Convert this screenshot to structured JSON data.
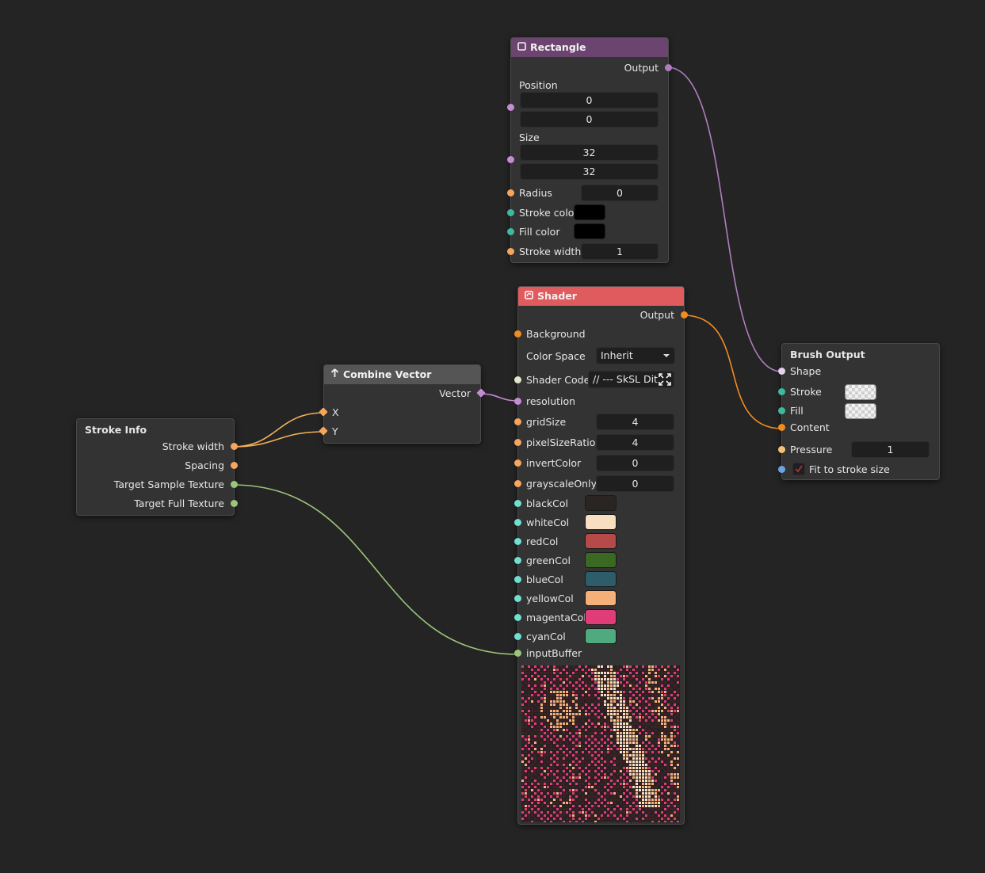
{
  "colors": {
    "canvas": "#242424",
    "rectangle_header": "#6b456f",
    "shader_header": "#e05b5e",
    "combine_header": "#555555",
    "wire_shape": "#b07cc0",
    "wire_number": "#f2b05a",
    "wire_texture": "#9cc47a",
    "wire_content": "#f08c22",
    "socket_shape": "#c58bd4",
    "socket_number": "#f5a55c",
    "socket_color": "#3fb8a0",
    "socket_texture": "#9cc47a",
    "socket_vector": "#c58bd4",
    "socket_bool": "#6fa3e0",
    "socket_paint": "#f08c22",
    "socket_string": "#dfe8c8",
    "socket_color_light": "#6fe0d0"
  },
  "nodes": {
    "stroke_info": {
      "title": "Stroke Info",
      "outputs": [
        "Stroke width",
        "Spacing",
        "Target Sample Texture",
        "Target Full Texture"
      ]
    },
    "combine_vector": {
      "icon": "arrow-up-icon",
      "title": "Combine Vector",
      "output": "Vector",
      "inputs": [
        "X",
        "Y"
      ]
    },
    "rectangle": {
      "icon": "square-icon",
      "title": "Rectangle",
      "output": "Output",
      "position_label": "Position",
      "position": [
        "0",
        "0"
      ],
      "size_label": "Size",
      "size": [
        "32",
        "32"
      ],
      "radius_label": "Radius",
      "radius": "0",
      "stroke_color_label": "Stroke colo",
      "stroke_color": "#000000",
      "fill_color_label": "Fill color",
      "fill_color": "#000000",
      "stroke_width_label": "Stroke width",
      "stroke_width": "1"
    },
    "shader": {
      "icon": "shader-icon",
      "title": "Shader",
      "output": "Output",
      "background_label": "Background",
      "color_space_label": "Color Space",
      "color_space_value": "Inherit",
      "shader_code_label": "Shader Code",
      "shader_code_value": "// --- SkSL Dith",
      "expand_icon": "expand-icon",
      "resolution_label": "resolution",
      "numbers": [
        {
          "label": "gridSize",
          "value": "4"
        },
        {
          "label": "pixelSizeRatio",
          "value": "4"
        },
        {
          "label": "invertColor",
          "value": "0"
        },
        {
          "label": "grayscaleOnly",
          "value": "0"
        }
      ],
      "colors": [
        {
          "label": "blackCol",
          "color": "#2a2523"
        },
        {
          "label": "whiteCol",
          "color": "#f8dfc0"
        },
        {
          "label": "redCol",
          "color": "#b64a48"
        },
        {
          "label": "greenCol",
          "color": "#3a6a22"
        },
        {
          "label": "blueCol",
          "color": "#2d5d6a"
        },
        {
          "label": "yellowCol",
          "color": "#f5b07a"
        },
        {
          "label": "magentaCol",
          "color": "#e03c78"
        },
        {
          "label": "cyanCol",
          "color": "#50aa80"
        }
      ],
      "input_buffer_label": "inputBuffer"
    },
    "brush_output": {
      "title": "Brush Output",
      "shape_label": "Shape",
      "stroke_label": "Stroke",
      "fill_label": "Fill",
      "content_label": "Content",
      "pressure_label": "Pressure",
      "pressure_value": "1",
      "fit_label": "Fit to stroke size",
      "fit_checked": true
    }
  }
}
